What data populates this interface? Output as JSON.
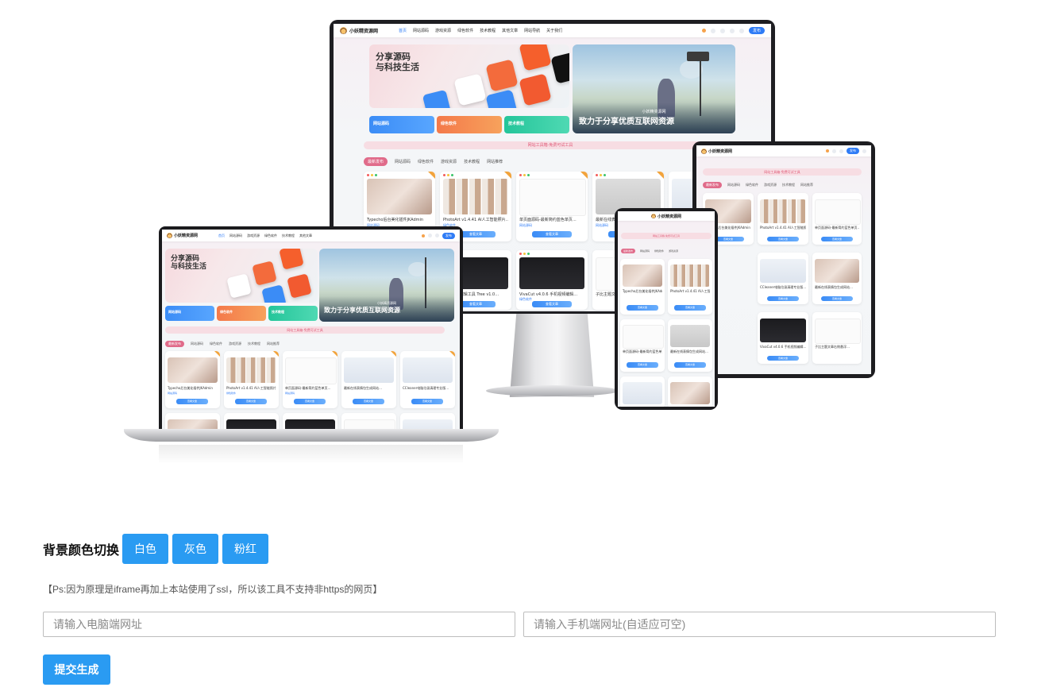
{
  "site": {
    "logo_text": "小妖精资源网",
    "nav": [
      "首页",
      "网站源码",
      "游戏资源",
      "绿色软件",
      "技术教程",
      "其他文章",
      "网站导航",
      "关于我们"
    ],
    "post_label": "发布",
    "hero_title_line1": "分享源码",
    "hero_title_line2": "与科技生活",
    "banner_small": "小妖精资源网",
    "banner_caption": "致力于分享优质互联网资源",
    "banner_more": "全部文章",
    "quick_buttons": [
      "网站源码",
      "绿色软件",
      "技术教程"
    ],
    "notice": "网站工具箱-免费可试工具",
    "categories": [
      "最新发布",
      "网站源码",
      "绿色软件",
      "游戏资源",
      "技术教程",
      "网站推荐"
    ],
    "cards": [
      {
        "title": "Typecho后台美化插件JKAdmin",
        "tag": "网站源码",
        "btn": "查看文章"
      },
      {
        "title": "PhotoArt v1.4.41 AI人工智能照片…",
        "tag": "绿色软件",
        "btn": "查看文章"
      },
      {
        "title": "单页面源码-最新简约蓝色单页…",
        "tag": "网站源码",
        "btn": "查看文章"
      },
      {
        "title": "最新在线表情包生成网站…",
        "tag": "网站源码",
        "btn": "查看文章"
      },
      {
        "title": "CCleaner电脑垃圾清理专业版…",
        "tag": "绿色软件",
        "btn": "查看文章"
      },
      {
        "title": "Viva自动编辑工具 Tree v1.0…",
        "tag": "绿色软件",
        "btn": "查看文章"
      },
      {
        "title": "VivaCut v4.0.6 手机视频编辑…",
        "tag": "绿色软件",
        "btn": "查看文章"
      },
      {
        "title": "子比主题文章右侧悬浮…",
        "tag": "网站源码",
        "btn": "查看文章"
      }
    ]
  },
  "controls": {
    "bg_switch_label": "背景颜色切换",
    "bg_buttons": [
      "白色",
      "灰色",
      "粉红"
    ],
    "ps_note": "【Ps:因为原理是iframe再加上本站使用了ssl，所以该工具不支持非https的网页】",
    "pc_url_placeholder": "请输入电脑端网址",
    "mobile_url_placeholder": "请输入手机端网址(自适应可空)",
    "submit_label": "提交生成"
  },
  "colors": {
    "accent": "#2a9bf2",
    "site_blue": "#2f7cf6",
    "site_pink": "#e06b8a"
  }
}
